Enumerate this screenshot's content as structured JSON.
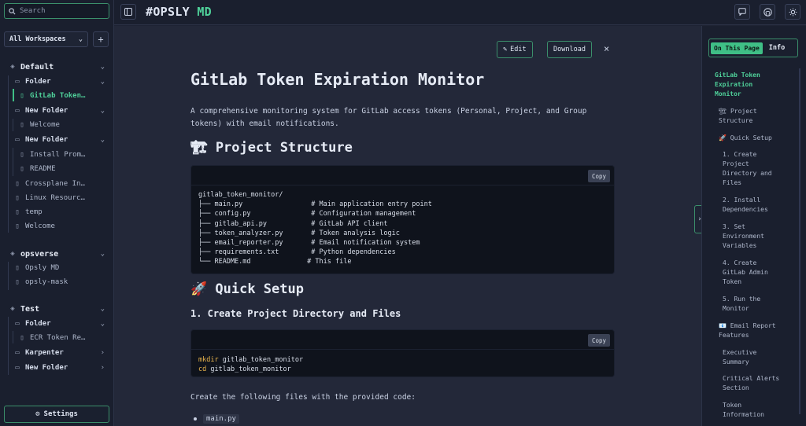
{
  "search": {
    "label": "Search"
  },
  "workspace_select": {
    "value": "All Workspaces",
    "add_label": "+"
  },
  "sidebar": {
    "workspaces": [
      {
        "name": "Default",
        "items": [
          {
            "label": "Folder",
            "type": "folder",
            "depth": 1,
            "expanded": true
          },
          {
            "label": "GitLab Token…",
            "type": "file",
            "depth": 2,
            "active": true
          },
          {
            "label": "New Folder",
            "type": "folder",
            "depth": 1,
            "expanded": true
          },
          {
            "label": "Welcome",
            "type": "file",
            "depth": 2
          },
          {
            "label": "New Folder",
            "type": "folder",
            "depth": 1,
            "expanded": true
          },
          {
            "label": "Install Prom…",
            "type": "file",
            "depth": 2
          },
          {
            "label": "README",
            "type": "file",
            "depth": 2
          },
          {
            "label": "Crossplane In…",
            "type": "file",
            "depth": 1
          },
          {
            "label": "Linux Resourc…",
            "type": "file",
            "depth": 1
          },
          {
            "label": "temp",
            "type": "file",
            "depth": 1
          },
          {
            "label": "Welcome",
            "type": "file",
            "depth": 1
          }
        ]
      },
      {
        "name": "opsverse",
        "items": [
          {
            "label": "Opsly MD",
            "type": "file",
            "depth": 1
          },
          {
            "label": "opsly-mask",
            "type": "file",
            "depth": 1
          }
        ]
      },
      {
        "name": "Test",
        "items": [
          {
            "label": "Folder",
            "type": "folder",
            "depth": 1,
            "expanded": true
          },
          {
            "label": "ECR Token Re…",
            "type": "file",
            "depth": 2
          },
          {
            "label": "Karpenter",
            "type": "folder",
            "depth": 1,
            "expanded": false
          },
          {
            "label": "New Folder",
            "type": "folder",
            "depth": 1,
            "expanded": false
          }
        ]
      }
    ],
    "settings_label": "Settings"
  },
  "header": {
    "brand_prefix": "#OPSLY",
    "brand_suffix": "MD"
  },
  "toolbar": {
    "edit_label": "Edit",
    "download_label": "Download",
    "close_label": "×"
  },
  "doc": {
    "title": "GitLab Token Expiration Monitor",
    "intro": "A comprehensive monitoring system for GitLab access tokens (Personal, Project, and Group tokens) with email notifications.",
    "h_structure": "🏗 Project Structure",
    "copy_label": "Copy",
    "tree_code": "gitlab_token_monitor/\n├── main.py                 # Main application entry point\n├── config.py               # Configuration management\n├── gitlab_api.py           # GitLab API client\n├── token_analyzer.py       # Token analysis logic\n├── email_reporter.py       # Email notification system\n├── requirements.txt        # Python dependencies\n└── README.md              # This file",
    "h_setup": "🚀 Quick Setup",
    "h_step1": "1. Create Project Directory and Files",
    "cmd1_kw": "mkdir",
    "cmd1_arg": " gitlab_token_monitor",
    "cmd2_kw": "cd",
    "cmd2_arg": " gitlab_token_monitor",
    "files_para": "Create the following files with the provided code:",
    "bullet_1": "main.py"
  },
  "toc": {
    "tab_on": "On This Page",
    "tab_off": "Info",
    "items": [
      "GitLab Token Expiration Monitor",
      "🏗 Project Structure",
      "🚀 Quick Setup",
      "1. Create Project Directory and Files",
      "2. Install Dependencies",
      "3. Set Environment Variables",
      "4. Create GitLab Admin Token",
      "5. Run the Monitor",
      "📧 Email Report Features",
      "Executive Summary",
      "Critical Alerts Section",
      "Token Information"
    ]
  },
  "colors": {
    "accent": "#4fd19a",
    "background": "#232839",
    "sidebar": "#1a1f2e",
    "code_bg": "#0f131c"
  }
}
